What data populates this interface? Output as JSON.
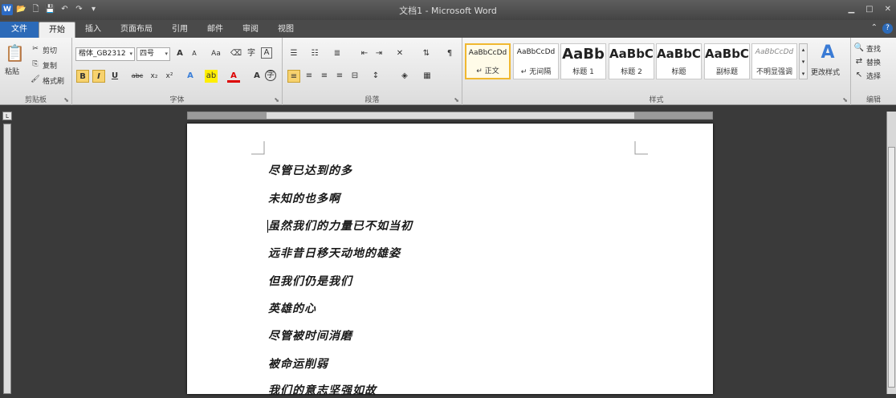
{
  "window": {
    "title": "文档1 - Microsoft Word",
    "minimize": "▁",
    "maximize": "□",
    "close": "✕"
  },
  "quick_access": {
    "app_icon": "W",
    "undo": "↶",
    "redo": "↷"
  },
  "tabs": [
    "文件",
    "开始",
    "插入",
    "页面布局",
    "引用",
    "邮件",
    "审阅",
    "视图"
  ],
  "active_tab": "开始",
  "clipboard": {
    "paste": "粘贴",
    "cut": "剪切",
    "copy": "复制",
    "format_painter": "格式刷",
    "group_label": "剪贴板"
  },
  "font": {
    "font_name": "楷体_GB2312",
    "font_size": "四号",
    "bold": "B",
    "italic": "I",
    "underline": "U",
    "strike": "abc",
    "subscript": "x₂",
    "superscript": "x²",
    "grow": "A",
    "shrink": "A",
    "change_case": "Aa",
    "group_label": "字体"
  },
  "paragraph": {
    "group_label": "段落"
  },
  "styles": {
    "items": [
      {
        "preview": "AaBbCcDd",
        "name": "↵ 正文"
      },
      {
        "preview": "AaBbCcDd",
        "name": "↵ 无间隔"
      },
      {
        "preview": "AaBb",
        "name": "标题 1"
      },
      {
        "preview": "AaBbC",
        "name": "标题 2"
      },
      {
        "preview": "AaBbC",
        "name": "标题"
      },
      {
        "preview": "AaBbC",
        "name": "副标题"
      },
      {
        "preview": "AaBbCcDd",
        "name": "不明显强调"
      }
    ],
    "change_styles": "更改样式",
    "group_label": "样式"
  },
  "editing": {
    "find": "查找",
    "replace": "替换",
    "select": "选择",
    "group_label": "编辑"
  },
  "document": {
    "lines": [
      "尽管已达到的多",
      "未知的也多啊",
      "虽然我们的力量已不如当初",
      "远非昔日移天动地的雄姿",
      "但我们仍是我们",
      "英雄的心",
      "尽管被时间消磨",
      "被命运削弱",
      "我们的意志坚强如故"
    ]
  },
  "colors": {
    "file_tab": "#2c6ab8",
    "selected_style_border": "#f0b830"
  }
}
